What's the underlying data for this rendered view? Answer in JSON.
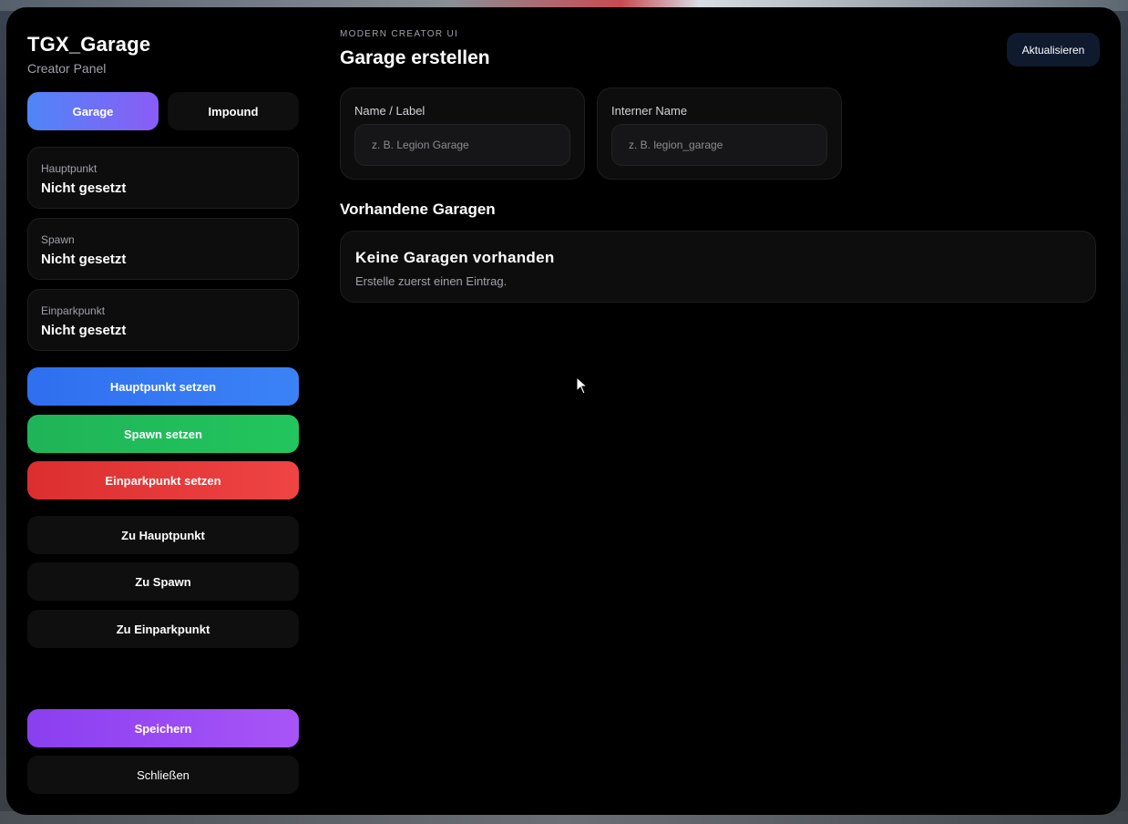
{
  "sidebar": {
    "title": "TGX_Garage",
    "subtitle": "Creator Panel",
    "tabs": [
      {
        "label": "Garage",
        "active": true
      },
      {
        "label": "Impound",
        "active": false
      }
    ],
    "points": [
      {
        "label": "Hauptpunkt",
        "value": "Nicht gesetzt"
      },
      {
        "label": "Spawn",
        "value": "Nicht gesetzt"
      },
      {
        "label": "Einparkpunkt",
        "value": "Nicht gesetzt"
      }
    ],
    "set_buttons": [
      {
        "label": "Hauptpunkt setzen",
        "color": "#3b82f6"
      },
      {
        "label": "Spawn setzen",
        "color": "#22c55e"
      },
      {
        "label": "Einparkpunkt setzen",
        "color": "#ef4444"
      }
    ],
    "goto_buttons": [
      {
        "label": "Zu Hauptpunkt"
      },
      {
        "label": "Zu Spawn"
      },
      {
        "label": "Zu Einparkpunkt"
      }
    ],
    "save_label": "Speichern",
    "close_label": "Schließen"
  },
  "main": {
    "eyebrow": "MODERN CREATOR UI",
    "title": "Garage erstellen",
    "refresh_label": "Aktualisieren",
    "fields": [
      {
        "label": "Name / Label",
        "placeholder": "z. B. Legion Garage",
        "value": ""
      },
      {
        "label": "Interner Name",
        "placeholder": "z. B. legion_garage",
        "value": ""
      }
    ],
    "existing_title": "Vorhandene Garagen",
    "empty_state": {
      "title": "Keine Garagen vorhanden",
      "text": "Erstelle zuerst einen Eintrag."
    }
  },
  "colors": {
    "panel_bg": "#000000",
    "card_bg": "#0d0d0e",
    "accent_blue": "#3b82f6",
    "accent_green": "#22c55e",
    "accent_red": "#ef4444",
    "accent_purple": "#a855f7"
  }
}
